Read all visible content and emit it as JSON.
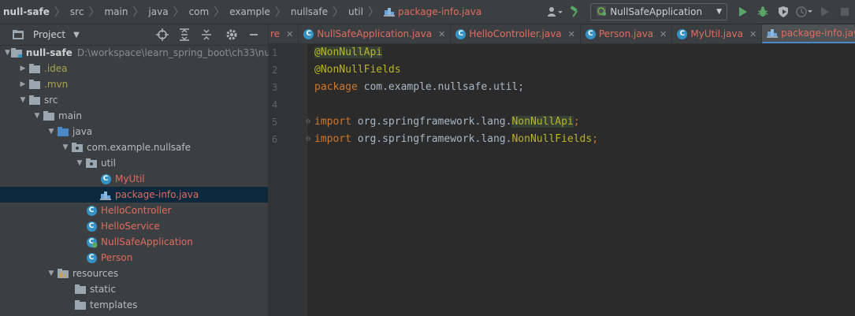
{
  "navbar": {
    "crumbs": [
      "null-safe",
      "src",
      "main",
      "java",
      "com",
      "example",
      "nullsafe",
      "util"
    ],
    "current_file": "package-info.java"
  },
  "run": {
    "config": "NullSafeApplication"
  },
  "project": {
    "title": "Project",
    "tree": [
      {
        "label": "null-safe",
        "path": "D:\\workspace\\learn_spring_boot\\ch33\\nu"
      },
      {
        "label": ".idea"
      },
      {
        "label": ".mvn"
      },
      {
        "label": "src"
      },
      {
        "label": "main"
      },
      {
        "label": "java"
      },
      {
        "label": "com.example.nullsafe"
      },
      {
        "label": "util"
      },
      {
        "label": "MyUtil"
      },
      {
        "label": "package-info.java"
      },
      {
        "label": "HelloController"
      },
      {
        "label": "HelloService"
      },
      {
        "label": "NullSafeApplication"
      },
      {
        "label": "Person"
      },
      {
        "label": "resources"
      },
      {
        "label": "static"
      },
      {
        "label": "templates"
      }
    ]
  },
  "tabs": [
    {
      "label": "NullSafeApplication.java"
    },
    {
      "label": "HelloController.java"
    },
    {
      "label": "Person.java"
    },
    {
      "label": "MyUtil.java"
    },
    {
      "label": "package-info.java"
    }
  ],
  "tab_fragment": "re",
  "editor": {
    "line_numbers": [
      "1",
      "2",
      "3",
      "4",
      "5",
      "6"
    ],
    "lines": [
      [
        "@NonNullApi"
      ],
      [
        "@NonNullFields"
      ],
      [
        "package",
        " com.example.nullsafe.util;"
      ],
      [],
      [
        "import",
        " org.springframework.lang.",
        "NonNullApi",
        ";"
      ],
      [
        "import",
        " org.springframework.lang.",
        "NonNullFields",
        ";"
      ]
    ]
  },
  "colors": {
    "accent": "#4a88c7",
    "file_modified": "#e06c60",
    "annotation": "#bbb529",
    "keyword": "#cc7832"
  }
}
